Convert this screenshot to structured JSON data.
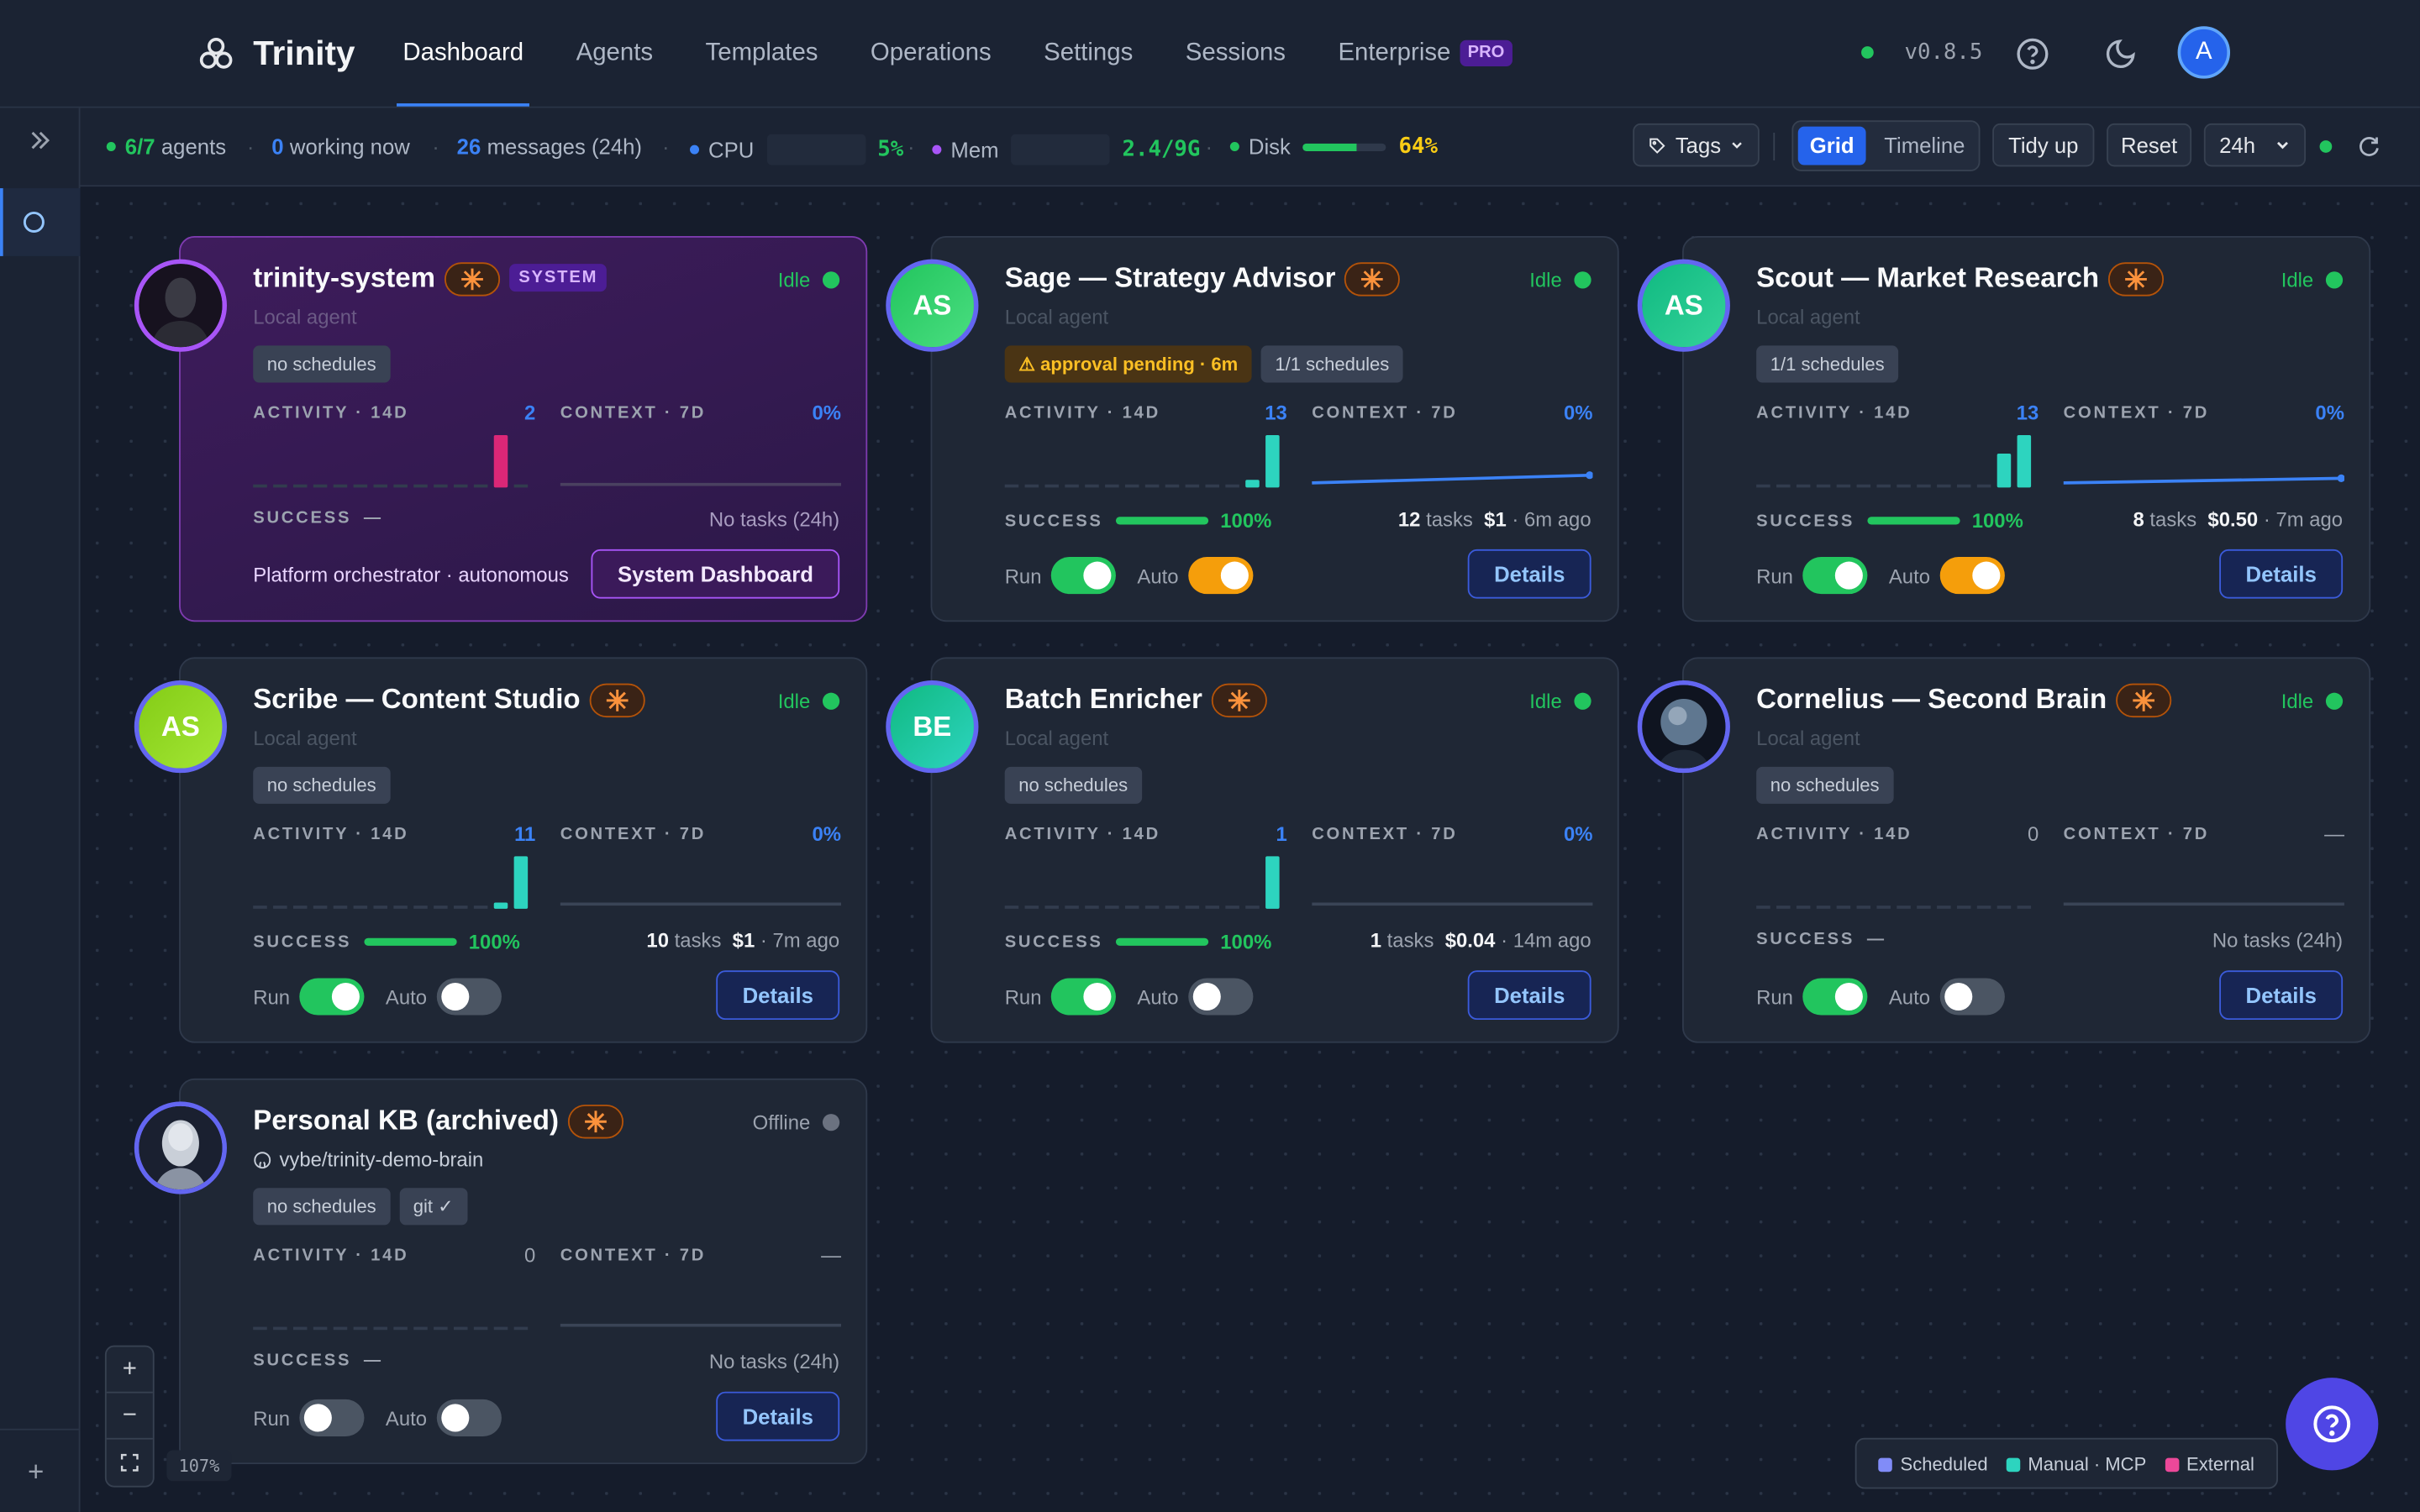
{
  "app": {
    "name": "Trinity",
    "version": "v0.8.5",
    "user_initial": "A"
  },
  "nav": {
    "items": [
      {
        "label": "Dashboard",
        "active": true
      },
      {
        "label": "Agents"
      },
      {
        "label": "Templates"
      },
      {
        "label": "Operations"
      },
      {
        "label": "Settings"
      },
      {
        "label": "Sessions"
      },
      {
        "label": "Enterprise",
        "badge": "PRO"
      }
    ]
  },
  "stats": {
    "agents_count": "6/7",
    "agents_label": "agents",
    "working_count": "0",
    "working_label": "working now",
    "messages_count": "26",
    "messages_label": "messages (24h)",
    "cpu_label": "CPU",
    "cpu_value": "5%",
    "cpu_pct": 5,
    "mem_label": "Mem",
    "mem_value": "2.4/9G",
    "disk_label": "Disk",
    "disk_value": "64%",
    "disk_pct": 64
  },
  "toolbar": {
    "tags_label": "Tags",
    "grid_label": "Grid",
    "timeline_label": "Timeline",
    "tidy_label": "Tidy up",
    "reset_label": "Reset",
    "range_value": "24h"
  },
  "labels": {
    "activity": "ACTIVITY · 14D",
    "context": "CONTEXT · 7D",
    "success": "SUCCESS",
    "run": "Run",
    "auto": "Auto",
    "details": "Details"
  },
  "agents": [
    {
      "name": "trinity-system",
      "system_badge": "SYSTEM",
      "status": "Idle",
      "subtitle": "Local agent",
      "chips": [
        "no schedules"
      ],
      "activity_count": "2",
      "activity": [
        0,
        0,
        0,
        0,
        0,
        0,
        0,
        0,
        0,
        0,
        0,
        0,
        0,
        0
      ],
      "context_pct": "0%",
      "success_dash": "—",
      "tasks_text": "No tasks (24h)",
      "footer_text": "Platform orchestrator · autonomous",
      "action_label": "System Dashboard"
    },
    {
      "name": "Sage — Strategy Advisor",
      "initials": "AS",
      "status": "Idle",
      "subtitle": "Local agent",
      "chips": [
        "⚠ approval pending · 6m",
        "1/1 schedules"
      ],
      "activity_count": "13",
      "context_pct": "0%",
      "success_pct": "100%",
      "success_rate": 100,
      "task_count": "12",
      "task_word": "tasks",
      "cost": "$1",
      "ago": "6m ago",
      "run_on": true,
      "auto_on": true
    },
    {
      "name": "Scout — Market Research",
      "initials": "AS",
      "status": "Idle",
      "subtitle": "Local agent",
      "chips": [
        "1/1 schedules"
      ],
      "activity_count": "13",
      "context_pct": "0%",
      "success_pct": "100%",
      "success_rate": 100,
      "task_count": "8",
      "task_word": "tasks",
      "cost": "$0.50",
      "ago": "7m ago",
      "run_on": true,
      "auto_on": true
    },
    {
      "name": "Scribe — Content Studio",
      "initials": "AS",
      "status": "Idle",
      "subtitle": "Local agent",
      "chips": [
        "no schedules"
      ],
      "activity_count": "11",
      "context_pct": "0%",
      "success_pct": "100%",
      "success_rate": 100,
      "task_count": "10",
      "task_word": "tasks",
      "cost": "$1",
      "ago": "7m ago",
      "run_on": true,
      "auto_on": false
    },
    {
      "name": "Batch Enricher",
      "initials": "BE",
      "status": "Idle",
      "subtitle": "Local agent",
      "chips": [
        "no schedules"
      ],
      "activity_count": "1",
      "context_pct": "0%",
      "success_pct": "100%",
      "success_rate": 100,
      "task_count": "1",
      "task_word": "tasks",
      "cost": "$0.04",
      "ago": "14m ago",
      "run_on": true,
      "auto_on": false
    },
    {
      "name": "Cornelius — Second Brain",
      "status": "Idle",
      "subtitle": "Local agent",
      "chips": [
        "no schedules"
      ],
      "activity_count": "0",
      "context_pct": "—",
      "success_dash": "—",
      "tasks_text": "No tasks (24h)",
      "run_on": true,
      "auto_on": false
    },
    {
      "name": "Personal KB (archived)",
      "status": "Offline",
      "subtitle": "vybe/trinity-demo-brain",
      "chips": [
        "no schedules",
        "git ✓"
      ],
      "activity_count": "0",
      "context_pct": "—",
      "success_dash": "—",
      "tasks_text": "No tasks (24h)",
      "run_on": false,
      "auto_on": false
    }
  ],
  "zoom": {
    "level": "107%"
  },
  "legend": {
    "scheduled": "Scheduled",
    "manual": "Manual · MCP",
    "external": "External"
  },
  "colors": {
    "accent": "#3b82f6",
    "success": "#22c55e",
    "warning": "#f59e0b",
    "system": "#a855f7",
    "teal": "#2dd4bf",
    "pink": "#ec4899"
  }
}
